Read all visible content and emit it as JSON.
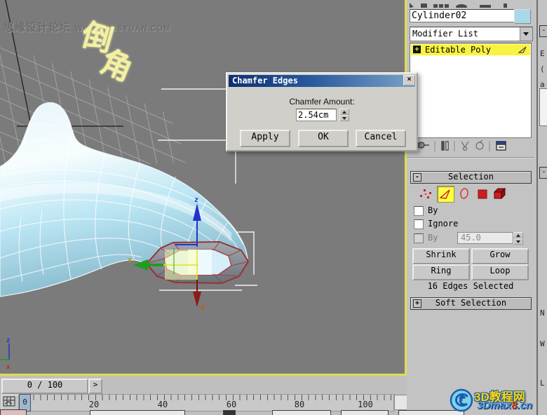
{
  "viewport": {
    "watermark_name": "思缘设计论坛",
    "watermark_url": "WWW.MISSYUAN.COM",
    "annotation_char1": "倒",
    "annotation_char2": "角",
    "gizmo": {
      "z": "z",
      "y": "Y",
      "x": "x"
    },
    "world_axis": {
      "z": "z",
      "x": "x"
    }
  },
  "dialog": {
    "title": "Chamfer Edges",
    "close_glyph": "×",
    "amount_label": "Chamfer Amount:",
    "amount_value": "2.54cm",
    "apply_label": "Apply",
    "ok_label": "OK",
    "cancel_label": "Cancel"
  },
  "panel": {
    "object_name": "Cylinder02",
    "modifier_list_label": "Modifier List",
    "stack_item": "Editable Poly",
    "stack_item_plus": "+",
    "minus_glyph": "-",
    "plus_glyph": "+",
    "selection_header": "Selection",
    "checkbox_by": "By",
    "checkbox_ignore": "Ignore",
    "checkbox_by_angle": "By",
    "angle_value": "45.0",
    "shrink_label": "Shrink",
    "grow_label": "Grow",
    "ring_label": "Ring",
    "loop_label": "Loop",
    "status_text": "16 Edges Selected",
    "soft_selection_header": "Soft Selection",
    "edge_fragments": [
      "E",
      "(",
      "a",
      "N",
      "W",
      "L"
    ]
  },
  "timeline": {
    "time_display": "0 / 100",
    "next_button": ">",
    "current_frame": "0",
    "ticks": [
      "0",
      "20",
      "40",
      "60",
      "80",
      "100"
    ]
  },
  "logo": {
    "title": "3D教程网",
    "url_blue1": "3Dmax",
    "url_red": "8",
    "url_blue2": ".cn"
  },
  "colors": {
    "viewport_bg": "#7b7b7b",
    "panel_bg": "#c3c3c3",
    "active_viewport_border": "#dede50",
    "stack_highlight": "#f8f340",
    "selection_red": "#b22222",
    "object_swatch": "#a9d9e9"
  }
}
